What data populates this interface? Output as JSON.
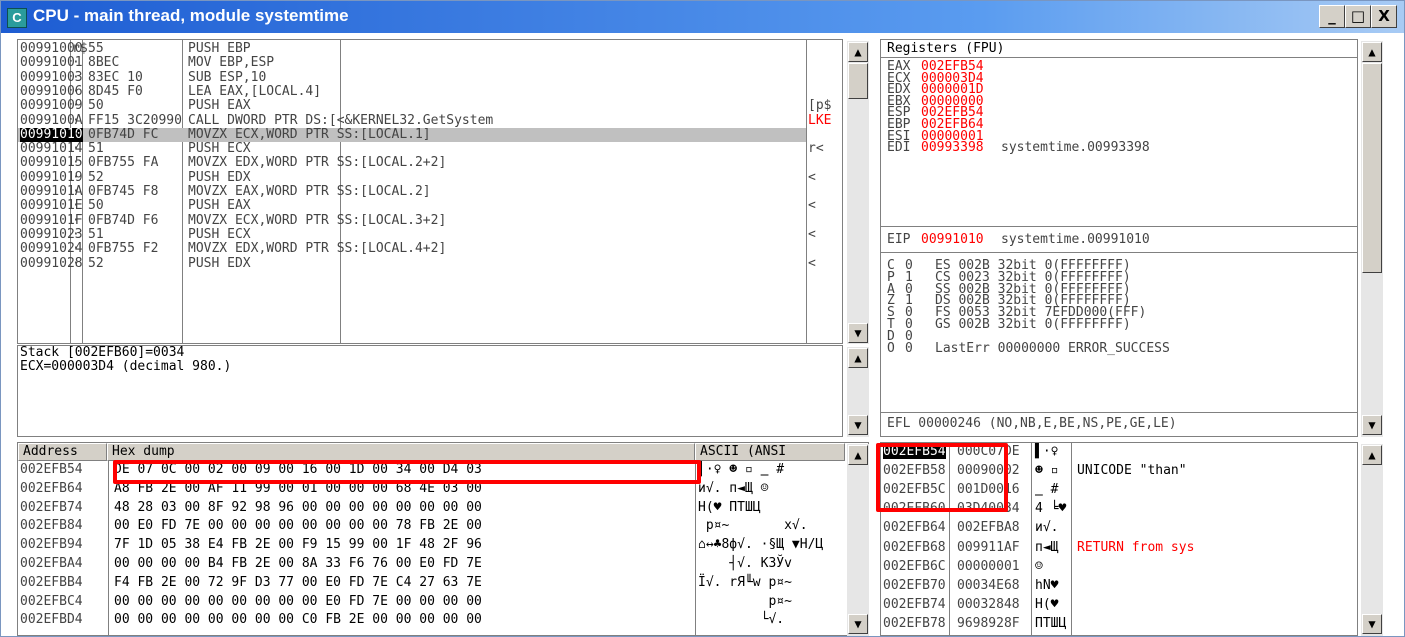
{
  "window": {
    "title": "CPU - main thread, module systemtime",
    "icon_letter": "C",
    "buttons": {
      "min": "_",
      "max": "□",
      "close": "X"
    }
  },
  "disasm": {
    "rows": [
      {
        "addr": "00991000",
        "mark": "r$",
        "hex": "55",
        "cmd": "PUSH EBP",
        "cm": ""
      },
      {
        "addr": "00991001",
        "mark": "·",
        "hex": "8BEC",
        "cmd": "MOV EBP,ESP",
        "cm": ""
      },
      {
        "addr": "00991003",
        "mark": "·",
        "hex": "83EC 10",
        "cmd": "SUB ESP,10",
        "cm": ""
      },
      {
        "addr": "00991006",
        "mark": "·",
        "hex": "8D45 F0",
        "cmd": "LEA EAX,[LOCAL.4]",
        "cm": ""
      },
      {
        "addr": "00991009",
        "mark": "·",
        "hex": "50",
        "cmd": "PUSH EAX",
        "cm": "[p$"
      },
      {
        "addr": "0099100A",
        "mark": "·",
        "hex": "FF15 3C20990",
        "cmd": "CALL DWORD PTR DS:[<&KERNEL32.GetSystem",
        "cm": "LKE"
      },
      {
        "addr": "00991010",
        "mark": "·",
        "hex": "0FB74D FC",
        "cmd": "MOVZX ECX,WORD PTR SS:[LOCAL.1]",
        "cm": ""
      },
      {
        "addr": "00991014",
        "mark": "·",
        "hex": "51",
        "cmd": "PUSH ECX",
        "cm": "r<"
      },
      {
        "addr": "00991015",
        "mark": "·",
        "hex": "0FB755 FA",
        "cmd": "MOVZX EDX,WORD PTR SS:[LOCAL.2+2]",
        "cm": ""
      },
      {
        "addr": "00991019",
        "mark": "·",
        "hex": "52",
        "cmd": "PUSH EDX",
        "cm": "<"
      },
      {
        "addr": "0099101A",
        "mark": "·",
        "hex": "0FB745 F8",
        "cmd": "MOVZX EAX,WORD PTR SS:[LOCAL.2]",
        "cm": ""
      },
      {
        "addr": "0099101E",
        "mark": "·",
        "hex": "50",
        "cmd": "PUSH EAX",
        "cm": "<"
      },
      {
        "addr": "0099101F",
        "mark": "·",
        "hex": "0FB74D F6",
        "cmd": "MOVZX ECX,WORD PTR SS:[LOCAL.3+2]",
        "cm": ""
      },
      {
        "addr": "00991023",
        "mark": "·",
        "hex": "51",
        "cmd": "PUSH ECX",
        "cm": "<"
      },
      {
        "addr": "00991024",
        "mark": "·",
        "hex": "0FB755 F2",
        "cmd": "MOVZX EDX,WORD PTR SS:[LOCAL.4+2]",
        "cm": ""
      },
      {
        "addr": "00991028",
        "mark": "·",
        "hex": "52",
        "cmd": "PUSH EDX",
        "cm": "<"
      }
    ]
  },
  "info": {
    "line1": "Stack [002EFB60]=0034",
    "line2": "ECX=000003D4 (decimal 980.)"
  },
  "registers": {
    "header": "Registers (FPU)",
    "gp": [
      {
        "n": "EAX",
        "v": "002EFB54",
        "c": ""
      },
      {
        "n": "ECX",
        "v": "000003D4",
        "c": ""
      },
      {
        "n": "EDX",
        "v": "0000001D",
        "c": ""
      },
      {
        "n": "EBX",
        "v": "00000000",
        "c": ""
      },
      {
        "n": "ESP",
        "v": "002EFB54",
        "c": ""
      },
      {
        "n": "EBP",
        "v": "002EFB64",
        "c": ""
      },
      {
        "n": "ESI",
        "v": "00000001",
        "c": ""
      },
      {
        "n": "EDI",
        "v": "00993398",
        "c": "systemtime.00993398"
      }
    ],
    "eip": {
      "n": "EIP",
      "v": "00991010",
      "c": "systemtime.00991010"
    },
    "flags": [
      {
        "f": "C",
        "v": "0",
        "seg": "ES 002B 32bit 0(FFFFFFFF)"
      },
      {
        "f": "P",
        "v": "1",
        "seg": "CS 0023 32bit 0(FFFFFFFF)"
      },
      {
        "f": "A",
        "v": "0",
        "seg": "SS 002B 32bit 0(FFFFFFFF)"
      },
      {
        "f": "Z",
        "v": "1",
        "seg": "DS 002B 32bit 0(FFFFFFFF)"
      },
      {
        "f": "S",
        "v": "0",
        "seg": "FS 0053 32bit 7EFDD000(FFF)"
      },
      {
        "f": "T",
        "v": "0",
        "seg": "GS 002B 32bit 0(FFFFFFFF)"
      },
      {
        "f": "D",
        "v": "0",
        "seg": ""
      },
      {
        "f": "O",
        "v": "0",
        "seg": "LastErr 00000000 ERROR_SUCCESS"
      }
    ],
    "efl": "EFL 00000246 (NO,NB,E,BE,NS,PE,GE,LE)"
  },
  "dump": {
    "headers": {
      "address": "Address",
      "hex": "Hex dump",
      "ascii": "ASCII (ANSI"
    },
    "rows": [
      {
        "a": "002EFB54",
        "h": "DE 07 0C 00 02 00 09 00 16 00 1D 00 34 00 D4 03",
        "t": "▌·♀ ☻ ▫ ‗ #"
      },
      {
        "a": "002EFB64",
        "h": "A8 FB 2E 00 AF 11 99 00 01 00 00 00 68 4E 03 00",
        "t": "и√. п◄Щ ☺"
      },
      {
        "a": "002EFB74",
        "h": "48 28 03 00 8F 92 98 96 00 00 00 00 00 00 00 00",
        "t": "H(♥ ПТШЦ"
      },
      {
        "a": "002EFB84",
        "h": "00 E0 FD 7E 00 00 00 00 00 00 00 00 78 FB 2E 00",
        "t": " р¤~       x√."
      },
      {
        "a": "002EFB94",
        "h": "7F 1D 05 38 E4 FB 2E 00 F9 15 99 00 1F 48 2F 96",
        "t": "⌂↔♣8ф√. ·§Щ ▼H/Ц"
      },
      {
        "a": "002EFBA4",
        "h": "00 00 00 00 B4 FB 2E 00 8A 33 F6 76 00 E0 FD 7E",
        "t": "    ┤√. К3Ўv"
      },
      {
        "a": "002EFBB4",
        "h": "F4 FB 2E 00 72 9F D3 77 00 E0 FD 7E C4 27 63 7E",
        "t": "Ї√. rЯ╙w р¤~"
      },
      {
        "a": "002EFBC4",
        "h": "00 00 00 00 00 00 00 00 00 E0 FD 7E 00 00 00 00",
        "t": "         р¤~"
      },
      {
        "a": "002EFBD4",
        "h": "00 00 00 00 00 00 00 00 C0 FB 2E 00 00 00 00 00",
        "t": "        └√."
      }
    ]
  },
  "stack": {
    "rows": [
      {
        "a": "002EFB54",
        "v": "000C07DE",
        "t": "▌·♀",
        "c": "",
        "sel": true
      },
      {
        "a": "002EFB58",
        "v": "00090002",
        "t": "☻ ▫",
        "c": "UNICODE \"than\""
      },
      {
        "a": "002EFB5C",
        "v": "001D0016",
        "t": "‗ #",
        "c": ""
      },
      {
        "a": "002EFB60",
        "v": "03D40034",
        "t": "4 ╘♥",
        "c": ""
      },
      {
        "a": "002EFB64",
        "v": "002EFBA8",
        "t": "и√.",
        "c": ""
      },
      {
        "a": "002EFB68",
        "v": "009911AF",
        "t": "п◄Щ",
        "c": "RETURN from sys"
      },
      {
        "a": "002EFB6C",
        "v": "00000001",
        "t": "☺",
        "c": ""
      },
      {
        "a": "002EFB70",
        "v": "00034E68",
        "t": "hN♥",
        "c": ""
      },
      {
        "a": "002EFB74",
        "v": "00032848",
        "t": "H(♥",
        "c": ""
      },
      {
        "a": "002EFB78",
        "v": "9698928F",
        "t": "ПТШЦ",
        "c": ""
      }
    ]
  }
}
